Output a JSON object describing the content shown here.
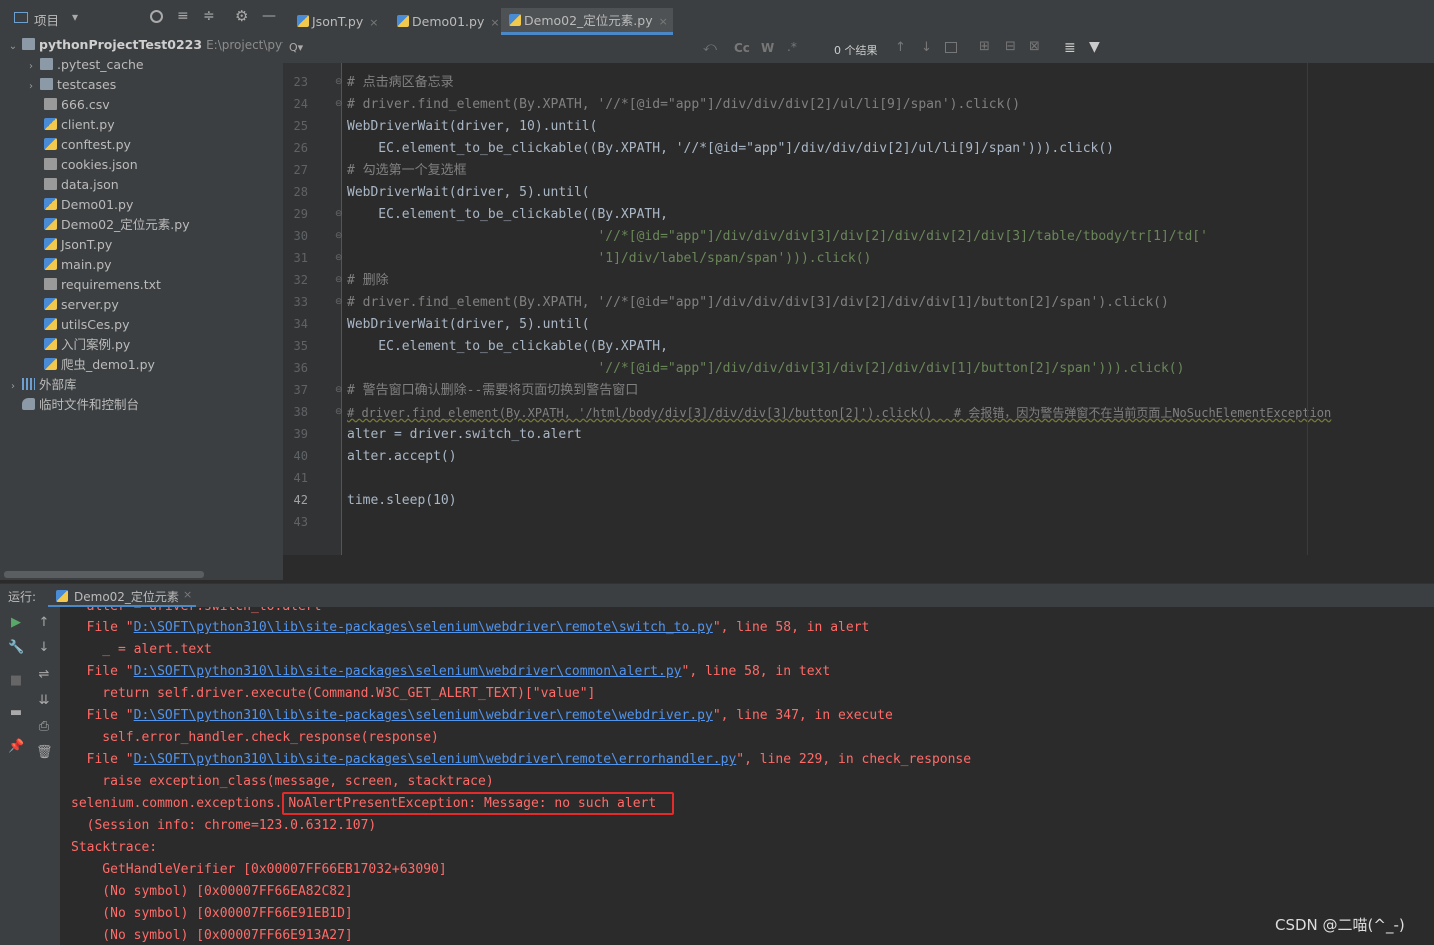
{
  "project_toolbar": {
    "title": "项目",
    "dropdown": "▾",
    "icons": [
      "target-icon",
      "expand-all-icon",
      "collapse-all-icon",
      "settings-icon",
      "hide-icon"
    ]
  },
  "tree": {
    "root": {
      "name": "pythonProjectTest0223",
      "path": "E:\\project\\pytho"
    },
    "items": [
      {
        "label": ".pytest_cache",
        "kind": "folder",
        "expandable": true
      },
      {
        "label": "testcases",
        "kind": "folder",
        "expandable": true
      },
      {
        "label": "666.csv",
        "kind": "file"
      },
      {
        "label": "client.py",
        "kind": "py"
      },
      {
        "label": "conftest.py",
        "kind": "py"
      },
      {
        "label": "cookies.json",
        "kind": "file"
      },
      {
        "label": "data.json",
        "kind": "file"
      },
      {
        "label": "Demo01.py",
        "kind": "py"
      },
      {
        "label": "Demo02_定位元素.py",
        "kind": "py"
      },
      {
        "label": "JsonT.py",
        "kind": "py"
      },
      {
        "label": "main.py",
        "kind": "py"
      },
      {
        "label": "requiremens.txt",
        "kind": "file"
      },
      {
        "label": "server.py",
        "kind": "py"
      },
      {
        "label": "utilsCes.py",
        "kind": "py"
      },
      {
        "label": "入门案例.py",
        "kind": "py"
      },
      {
        "label": "爬虫_demo1.py",
        "kind": "py"
      }
    ],
    "external": "外部库",
    "scratches": "临时文件和控制台"
  },
  "tabs": [
    {
      "label": "JsonT.py",
      "close": "×"
    },
    {
      "label": "Demo01.py",
      "close": "×"
    },
    {
      "label": "Demo02_定位元素.py",
      "close": "×",
      "active": true
    }
  ],
  "find": {
    "search_icon": "Q▾",
    "cc": "Cc",
    "w": "W",
    "regex": ".*",
    "results": "0 个结果"
  },
  "editor": {
    "line_numbers": [
      "23",
      "24",
      "25",
      "26",
      "27",
      "28",
      "29",
      "30",
      "31",
      "32",
      "33",
      "34",
      "35",
      "36",
      "37",
      "38",
      "39",
      "40",
      "41",
      "42",
      "43"
    ],
    "current_line": "42",
    "lines": [
      "# 点击病区备忘录",
      "# driver.find_element(By.XPATH, '//*[@id=\"app\"]/div/div/div[2]/ul/li[9]/span').click()",
      "WebDriverWait(driver, 10).until(",
      "    EC.element_to_be_clickable((By.XPATH, '//*[@id=\"app\"]/div/div/div[2]/ul/li[9]/span'))).click()",
      "# 勾选第一个复选框",
      "WebDriverWait(driver, 5).until(",
      "    EC.element_to_be_clickable((By.XPATH,",
      "                                '//*[@id=\"app\"]/div/div/div[3]/div[2]/div/div[2]/div[3]/table/tbody/tr[1]/td['",
      "                                '1]/div/label/span/span'))).click()",
      "# 删除",
      "# driver.find_element(By.XPATH, '//*[@id=\"app\"]/div/div/div[3]/div[2]/div/div[1]/button[2]/span').click()",
      "WebDriverWait(driver, 5).until(",
      "    EC.element_to_be_clickable((By.XPATH,",
      "                                '//*[@id=\"app\"]/div/div/div[3]/div[2]/div/div[1]/button[2]/span'))).click()",
      "# 警告窗口确认删除--需要将页面切换到警告窗口",
      "# driver.find_element(By.XPATH, '/html/body/div[3]/div/div[3]/button[2]').click()   # 会报错，因为警告弹窗不在当前页面上NoSuchElementException",
      "alter = driver.switch_to.alert",
      "alter.accept()",
      "",
      "time.sleep(10)",
      ""
    ]
  },
  "run": {
    "label": "运行:",
    "tab": "Demo02_定位元素",
    "close": "×"
  },
  "console": {
    "partial_top": "  alter = driver.switch_to.alert",
    "lines": [
      {
        "pre": "  File \"",
        "link": "D:\\SOFT\\python310\\lib\\site-packages\\selenium\\webdriver\\remote\\switch_to.py",
        "post": "\", line 58, in alert"
      },
      {
        "text": "    _ = alert.text"
      },
      {
        "pre": "  File \"",
        "link": "D:\\SOFT\\python310\\lib\\site-packages\\selenium\\webdriver\\common\\alert.py",
        "post": "\", line 58, in text"
      },
      {
        "text": "    return self.driver.execute(Command.W3C_GET_ALERT_TEXT)[\"value\"]"
      },
      {
        "pre": "  File \"",
        "link": "D:\\SOFT\\python310\\lib\\site-packages\\selenium\\webdriver\\remote\\webdriver.py",
        "post": "\", line 347, in execute"
      },
      {
        "text": "    self.error_handler.check_response(response)"
      },
      {
        "pre": "  File \"",
        "link": "D:\\SOFT\\python310\\lib\\site-packages\\selenium\\webdriver\\remote\\errorhandler.py",
        "post": "\", line 229, in check_response"
      },
      {
        "text": "    raise exception_class(message, screen, stacktrace)"
      },
      {
        "exc_prefix": "selenium.common.exceptions.",
        "exc_boxed": "NoAlertPresentException: Message: no such alert"
      },
      {
        "text": "  (Session info: chrome=123.0.6312.107)"
      },
      {
        "text": "Stacktrace:"
      },
      {
        "text": "    GetHandleVerifier [0x00007FF66EB17032+63090]"
      },
      {
        "text": "    (No symbol) [0x00007FF66EA82C82]"
      },
      {
        "text": "    (No symbol) [0x00007FF66E91EB1D]"
      },
      {
        "text": "    (No symbol) [0x00007FF66E913A27]"
      }
    ]
  },
  "watermark": "CSDN @二喵(^_-)"
}
